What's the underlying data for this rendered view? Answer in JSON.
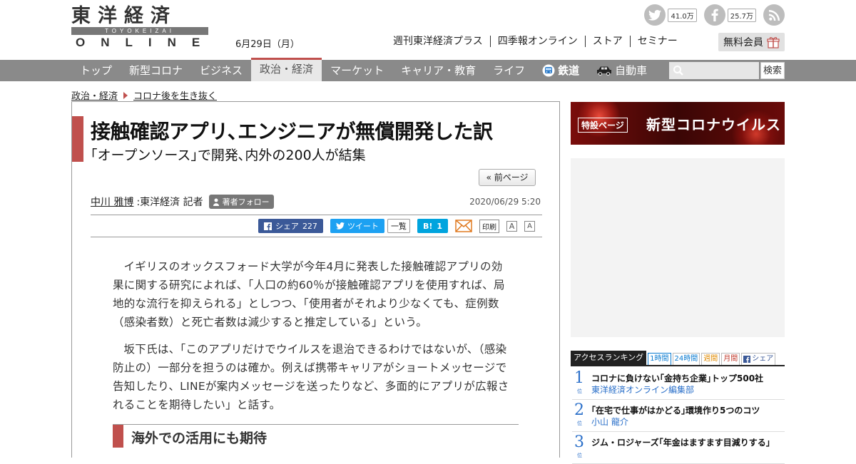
{
  "header": {
    "logo_kanji": "東洋経済",
    "logo_romaji": "TOYOKEIZAI",
    "logo_online": "ONLINE",
    "date": "6月29日（月）",
    "social": [
      {
        "icon": "twitter-icon",
        "count": "41.0万"
      },
      {
        "icon": "facebook-icon",
        "count": "25.7万"
      },
      {
        "icon": "rss-icon"
      }
    ],
    "links": [
      "週刊東洋経済プラス",
      "四季報オンライン",
      "ストア",
      "セミナー"
    ],
    "member_label": "無料会員"
  },
  "nav": {
    "items": [
      "トップ",
      "新型コロナ",
      "ビジネス",
      "政治・経済",
      "マーケット",
      "キャリア・教育",
      "ライフ",
      "鉄道",
      "自動車"
    ],
    "active": "政治・経済",
    "search_button": "検索"
  },
  "breadcrumb": [
    "政治・経済",
    "コロナ後を生き抜く"
  ],
  "article": {
    "title": "接触確認アプリ､エンジニアが無償開発した訳",
    "subtitle": "｢オープンソース｣で開発､内外の200人が結集",
    "prev_page": "« 前ページ",
    "author": "中川 雅博",
    "affiliation": ":東洋経済 記者",
    "follow_label": "著者フォロー",
    "pubdate": "2020/06/29 5:20",
    "share": {
      "facebook_label": "シェア",
      "facebook_count": "227",
      "tweet_label": "ツイート",
      "tweet_list": "一覧",
      "hatena_label": "B!",
      "hatena_count": "1",
      "print_label": "印刷",
      "font_small": "A",
      "font_large": "A"
    },
    "paragraphs": [
      "イギリスのオックスフォード大学が今年4月に発表した接触確認アプリの効果に関する研究によれば、「人口の約60％が接触確認アプリを使用すれば、局地的な流行を抑えられる」としつつ、「使用者がそれより少なくても、症例数（感染者数）と死亡者数は減少すると推定している」という。",
      "坂下氏は、「このアプリだけでウイルスを退治できるわけではないが、（感染防止の）一部分を担うのは確か。例えば携帯キャリアがショートメッセージで告知したり、LINEが案内メッセージを送ったりなど、多面的にアプリが広報されることを期待したい」と話す。"
    ],
    "section_heading": "海外での活用にも期待"
  },
  "sidebar": {
    "banner_tag": "特設ページ",
    "banner_label": "新型コロナウイルス",
    "ranking_title": "アクセスランキング",
    "ranking_tabs": [
      "1時間",
      "24時間",
      "週間",
      "月間",
      "シェア"
    ],
    "ranking_unit": "位",
    "ranking": [
      {
        "rank": "1",
        "title": "コロナに負けない｢金持ち企業｣トップ500社",
        "source": "東洋経済オンライン編集部"
      },
      {
        "rank": "2",
        "title": "｢在宅で仕事がはかどる｣環境作り5つのコツ",
        "source": "小山 龍介"
      },
      {
        "rank": "3",
        "title": "ジム・ロジャーズ｢年金はますます目減りする｣",
        "source": ""
      }
    ]
  },
  "colors": {
    "accent": "#c0504d",
    "nav_bg": "#8a8a8a",
    "link_blue": "#2a6fc9",
    "facebook": "#3b5998",
    "twitter": "#1da1f2",
    "hatena": "#00a4de"
  }
}
